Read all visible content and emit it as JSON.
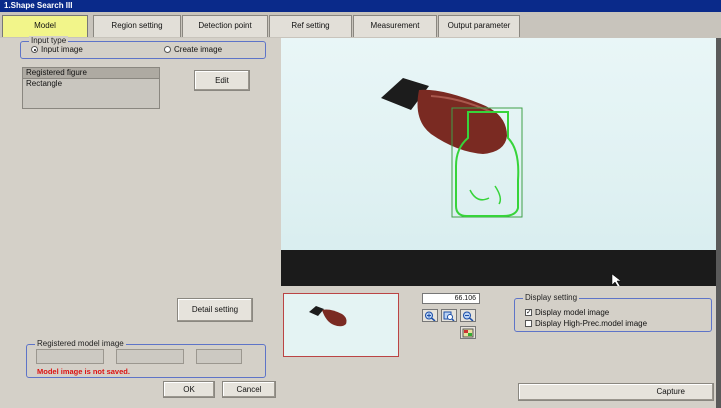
{
  "window": {
    "title": "1.Shape Search III"
  },
  "tabs": [
    {
      "label": "Model",
      "active": true
    },
    {
      "label": "Region setting"
    },
    {
      "label": "Detection point"
    },
    {
      "label": "Ref setting"
    },
    {
      "label": "Measurement"
    },
    {
      "label": "Output parameter"
    }
  ],
  "input_type": {
    "title": "Input type",
    "option_input_image": "Input image",
    "option_create_image": "Create image",
    "selected": "Input image"
  },
  "registered_figure": {
    "header": "Registered figure",
    "items": [
      "Rectangle"
    ]
  },
  "buttons": {
    "edit": "Edit",
    "detail_setting": "Detail setting",
    "ok": "OK",
    "cancel": "Cancel",
    "capture": "Capture"
  },
  "registered_model_image": {
    "title": "Registered model image",
    "status": "Model image is not saved.",
    "status_color": "#dd1111"
  },
  "zoom": {
    "value": "66.106"
  },
  "display_setting": {
    "title": "Display setting",
    "display_model_image": "Display model image",
    "display_model_image_checked": true,
    "display_high_prec": "Display High-Prec.model image",
    "display_high_prec_checked": false
  },
  "icons": {
    "zoom_in": "zoom-in-icon",
    "zoom_fit": "zoom-fit-icon",
    "zoom_out": "zoom-out-icon",
    "image_select": "image-select-icon",
    "cursor": "mouse-cursor-icon"
  },
  "colors": {
    "active_tab": "#f2f58a",
    "group_border": "#5e74c8",
    "model_outline": "#37d43a",
    "search_outline": "#3fa048",
    "title_bar": "#0a2a8a"
  }
}
